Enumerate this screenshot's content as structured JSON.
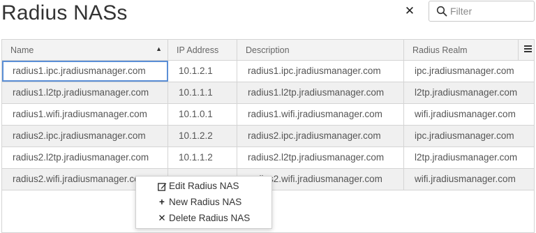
{
  "page_title": "Radius NASs",
  "toolbar": {
    "clear_icon": "close-icon",
    "filter_placeholder": "Filter",
    "filter_value": "",
    "search_icon": "search-icon"
  },
  "grid": {
    "columns": [
      {
        "label": "Name",
        "sort": "ascending"
      },
      {
        "label": "IP Address"
      },
      {
        "label": "Description"
      },
      {
        "label": "Radius Realm"
      }
    ],
    "menu_icon": "hamburger-menu-icon",
    "rows": [
      {
        "name": "radius1.ipc.jradiusmanager.com",
        "ip": "10.1.2.1",
        "description": "radius1.ipc.jradiusmanager.com",
        "realm": "ipc.jradiusmanager.com"
      },
      {
        "name": "radius1.l2tp.jradiusmanager.com",
        "ip": "10.1.1.1",
        "description": "radius1.l2tp.jradiusmanager.com",
        "realm": "l2tp.jradiusmanager.com"
      },
      {
        "name": "radius1.wifi.jradiusmanager.com",
        "ip": "10.1.0.1",
        "description": "radius1.wifi.jradiusmanager.com",
        "realm": "wifi.jradiusmanager.com"
      },
      {
        "name": "radius2.ipc.jradiusmanager.com",
        "ip": "10.1.2.2",
        "description": "radius2.ipc.jradiusmanager.com",
        "realm": "ipc.jradiusmanager.com"
      },
      {
        "name": "radius2.l2tp.jradiusmanager.com",
        "ip": "10.1.1.2",
        "description": "radius2.l2tp.jradiusmanager.com",
        "realm": "l2tp.jradiusmanager.com"
      },
      {
        "name": "radius2.wifi.jradiusmanager.com",
        "ip": "",
        "description": "radius2.wifi.jradiusmanager.com",
        "realm": "wifi.jradiusmanager.com"
      }
    ]
  },
  "context_menu": {
    "items": [
      {
        "icon": "edit-icon",
        "label": "Edit Radius NAS"
      },
      {
        "icon": "plus-icon",
        "label": "New Radius NAS"
      },
      {
        "icon": "delete-icon",
        "label": "Delete Radius NAS"
      }
    ]
  },
  "colors": {
    "focus_border": "#5b8fd6",
    "alt_row": "#f0f0f0",
    "header_bg": "#f3f3f3"
  }
}
